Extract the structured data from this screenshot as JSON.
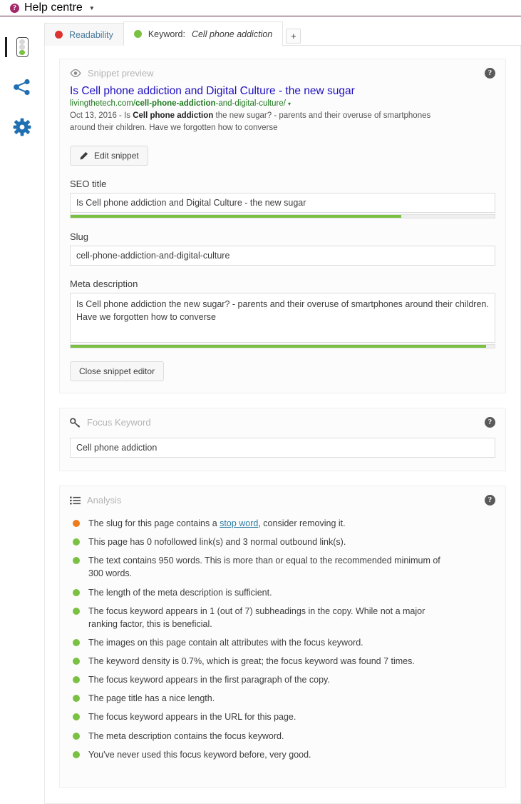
{
  "header": {
    "help_label": "Help centre",
    "help_icon": "question-circle-icon",
    "caret": "▼",
    "border_color": "#5b2942",
    "icon_color": "#a4286a"
  },
  "rail": {
    "items": [
      {
        "name": "seo-traffic-light",
        "icon": "traffic-light-icon",
        "active": true,
        "dots": [
          "#d8d8d8",
          "#d8d8d8",
          "#7ac143"
        ]
      },
      {
        "name": "social-share",
        "icon": "share-icon",
        "active": false
      },
      {
        "name": "settings",
        "icon": "gear-icon",
        "active": false
      }
    ]
  },
  "tabs": {
    "items": [
      {
        "label": "Readability",
        "keyword": "",
        "dot_color": "#dc3232",
        "active": false
      },
      {
        "label": "Keyword:",
        "keyword": "Cell phone addiction",
        "dot_color": "#7ac143",
        "active": true
      }
    ],
    "add_label": "+"
  },
  "snippet_preview": {
    "title": "Snippet preview",
    "icon": "eye-icon",
    "help_icon": "question-mark-icon",
    "help_label": "?",
    "result": {
      "title": "Is Cell phone addiction and Digital Culture - the new sugar",
      "url_domain": "livingthetech.com/",
      "url_bold": "cell-phone-addiction",
      "url_rest": "-and-digital-culture/",
      "url_caret": "▾",
      "date": "Oct 13, 2016 - ",
      "desc_pre": "Is ",
      "desc_bold": "Cell phone addiction",
      "desc_post": " the new sugar? - parents and their overuse of smartphones around their children. Have we forgotten how to converse"
    },
    "edit_button": "Edit snippet",
    "edit_icon": "pencil-icon",
    "close_button": "Close snippet editor",
    "fields": {
      "seo_title_label": "SEO title",
      "seo_title_value": "Is Cell phone addiction and Digital Culture - the new sugar",
      "seo_title_progress": 78,
      "slug_label": "Slug",
      "slug_value": "cell-phone-addiction-and-digital-culture",
      "meta_desc_label": "Meta description",
      "meta_desc_value": "Is Cell phone addiction the new sugar? - parents and their overuse of smartphones around their children. Have we forgotten how to converse",
      "meta_desc_progress": 98
    }
  },
  "focus_keyword": {
    "title": "Focus Keyword",
    "icon": "key-icon",
    "help_label": "?",
    "value": "Cell phone addiction",
    "placeholder": ""
  },
  "analysis": {
    "title": "Analysis",
    "icon": "list-icon",
    "help_label": "?",
    "items": [
      {
        "color": "#ee7c1b",
        "text_pre": "The slug for this page contains a ",
        "link": "stop word",
        "text_post": ", consider removing it."
      },
      {
        "color": "#7ac143",
        "text_pre": "This page has 0 nofollowed link(s) and 3 normal outbound link(s).",
        "link": "",
        "text_post": ""
      },
      {
        "color": "#7ac143",
        "text_pre": "The text contains 950 words. This is more than or equal to the recommended minimum of 300 words.",
        "link": "",
        "text_post": ""
      },
      {
        "color": "#7ac143",
        "text_pre": "The length of the meta description is sufficient.",
        "link": "",
        "text_post": ""
      },
      {
        "color": "#7ac143",
        "text_pre": "The focus keyword appears in 1 (out of 7) subheadings in the copy. While not a major ranking factor, this is beneficial.",
        "link": "",
        "text_post": ""
      },
      {
        "color": "#7ac143",
        "text_pre": "The images on this page contain alt attributes with the focus keyword.",
        "link": "",
        "text_post": ""
      },
      {
        "color": "#7ac143",
        "text_pre": "The keyword density is 0.7%, which is great; the focus keyword was found 7 times.",
        "link": "",
        "text_post": ""
      },
      {
        "color": "#7ac143",
        "text_pre": "The focus keyword appears in the first paragraph of the copy.",
        "link": "",
        "text_post": ""
      },
      {
        "color": "#7ac143",
        "text_pre": "The page title has a nice length.",
        "link": "",
        "text_post": ""
      },
      {
        "color": "#7ac143",
        "text_pre": "The focus keyword appears in the URL for this page.",
        "link": "",
        "text_post": ""
      },
      {
        "color": "#7ac143",
        "text_pre": "The meta description contains the focus keyword.",
        "link": "",
        "text_post": ""
      },
      {
        "color": "#7ac143",
        "text_pre": "You've never used this focus keyword before, very good.",
        "link": "",
        "text_post": ""
      }
    ]
  },
  "colors": {
    "accent": "#a4286a",
    "good": "#7ac143",
    "warn": "#ee7c1b",
    "bad": "#dc3232",
    "link": "#2b7ca3",
    "snippet_title": "#1e0fbe",
    "snippet_url": "#1f7a1f"
  }
}
